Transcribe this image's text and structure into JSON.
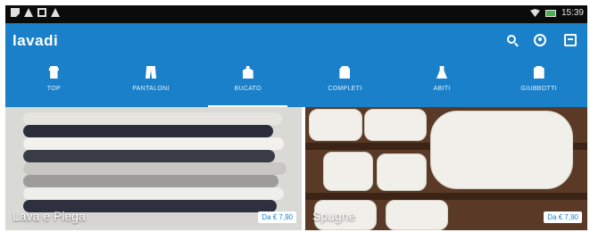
{
  "status_bar": {
    "time": "15:39"
  },
  "app_bar": {
    "logo_text": "lavadi",
    "brand_color": "#1a80c9",
    "actions": [
      "search-icon",
      "account-icon",
      "cart-icon"
    ]
  },
  "tabs": [
    {
      "label": "TOP",
      "icon": "shirt-icon",
      "active": false
    },
    {
      "label": "PANTALONI",
      "icon": "pants-icon",
      "active": false
    },
    {
      "label": "BUCATO",
      "icon": "laundry-bag-icon",
      "active": true
    },
    {
      "label": "COMPLETI",
      "icon": "suit-icon",
      "active": false
    },
    {
      "label": "ABITI",
      "icon": "dress-icon",
      "active": false
    },
    {
      "label": "GIUBBOTTI",
      "icon": "jacket-icon",
      "active": false
    }
  ],
  "tiles": [
    {
      "label": "Lava e Piega",
      "price": "Da € 7,90"
    },
    {
      "label": "Spugne",
      "price": "Da € 7,90"
    }
  ]
}
